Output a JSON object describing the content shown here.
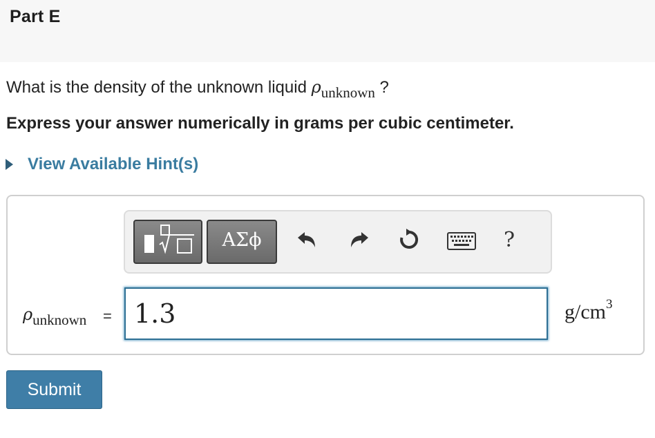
{
  "part": {
    "title": "Part E"
  },
  "question": {
    "prefix": "What is the density of the unknown liquid ",
    "symbol": "ρ",
    "subscript": "unknown",
    "suffix": " ?"
  },
  "instruction": "Express your answer numerically in grams per cubic centimeter.",
  "hint": {
    "label": "View Available Hint(s)"
  },
  "toolbar": {
    "templates_icon": "templates-icon",
    "greek_label": "ΑΣϕ",
    "undo_icon": "undo-icon",
    "redo_icon": "redo-icon",
    "reset_icon": "reset-icon",
    "keyboard_icon": "keyboard-icon",
    "help_label": "?"
  },
  "answer": {
    "symbol": "ρ",
    "subscript": "unknown",
    "equals": "=",
    "value": "1.3",
    "unit_base": "g/cm",
    "unit_exp": "3"
  },
  "submit": {
    "label": "Submit"
  },
  "colors": {
    "link": "#3a7ca0",
    "submit_bg": "#3f7ea7",
    "input_border": "#2e6f94",
    "toolbar_button": "#777777"
  }
}
